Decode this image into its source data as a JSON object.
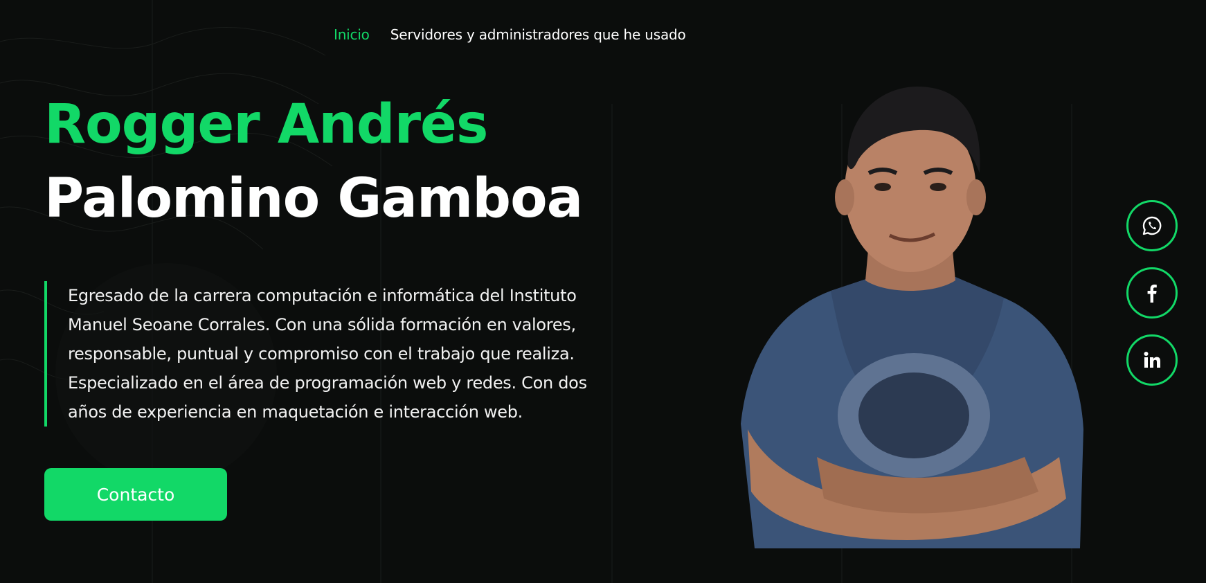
{
  "nav": {
    "items": [
      {
        "label": "Inicio",
        "active": true
      },
      {
        "label": "Servidores y administradores que he usado",
        "active": false
      }
    ]
  },
  "hero": {
    "name_first": "Rogger Andrés",
    "name_last": "Palomino Gamboa",
    "description": "Egresado de la carrera computación e informática del Instituto Manuel Seoane Corrales. Con una sólida formación en valores, responsable, puntual y compromiso con el trabajo que realiza. Especializado en el área de programación web y redes. Con dos años de experiencia en maquetación e interacción web.",
    "contact_label": "Contacto"
  },
  "social": [
    {
      "icon": "whatsapp-icon"
    },
    {
      "icon": "facebook-icon"
    },
    {
      "icon": "linkedin-icon"
    }
  ],
  "colors": {
    "accent": "#12d867",
    "background": "#0b0d0c",
    "text": "#ffffff"
  }
}
